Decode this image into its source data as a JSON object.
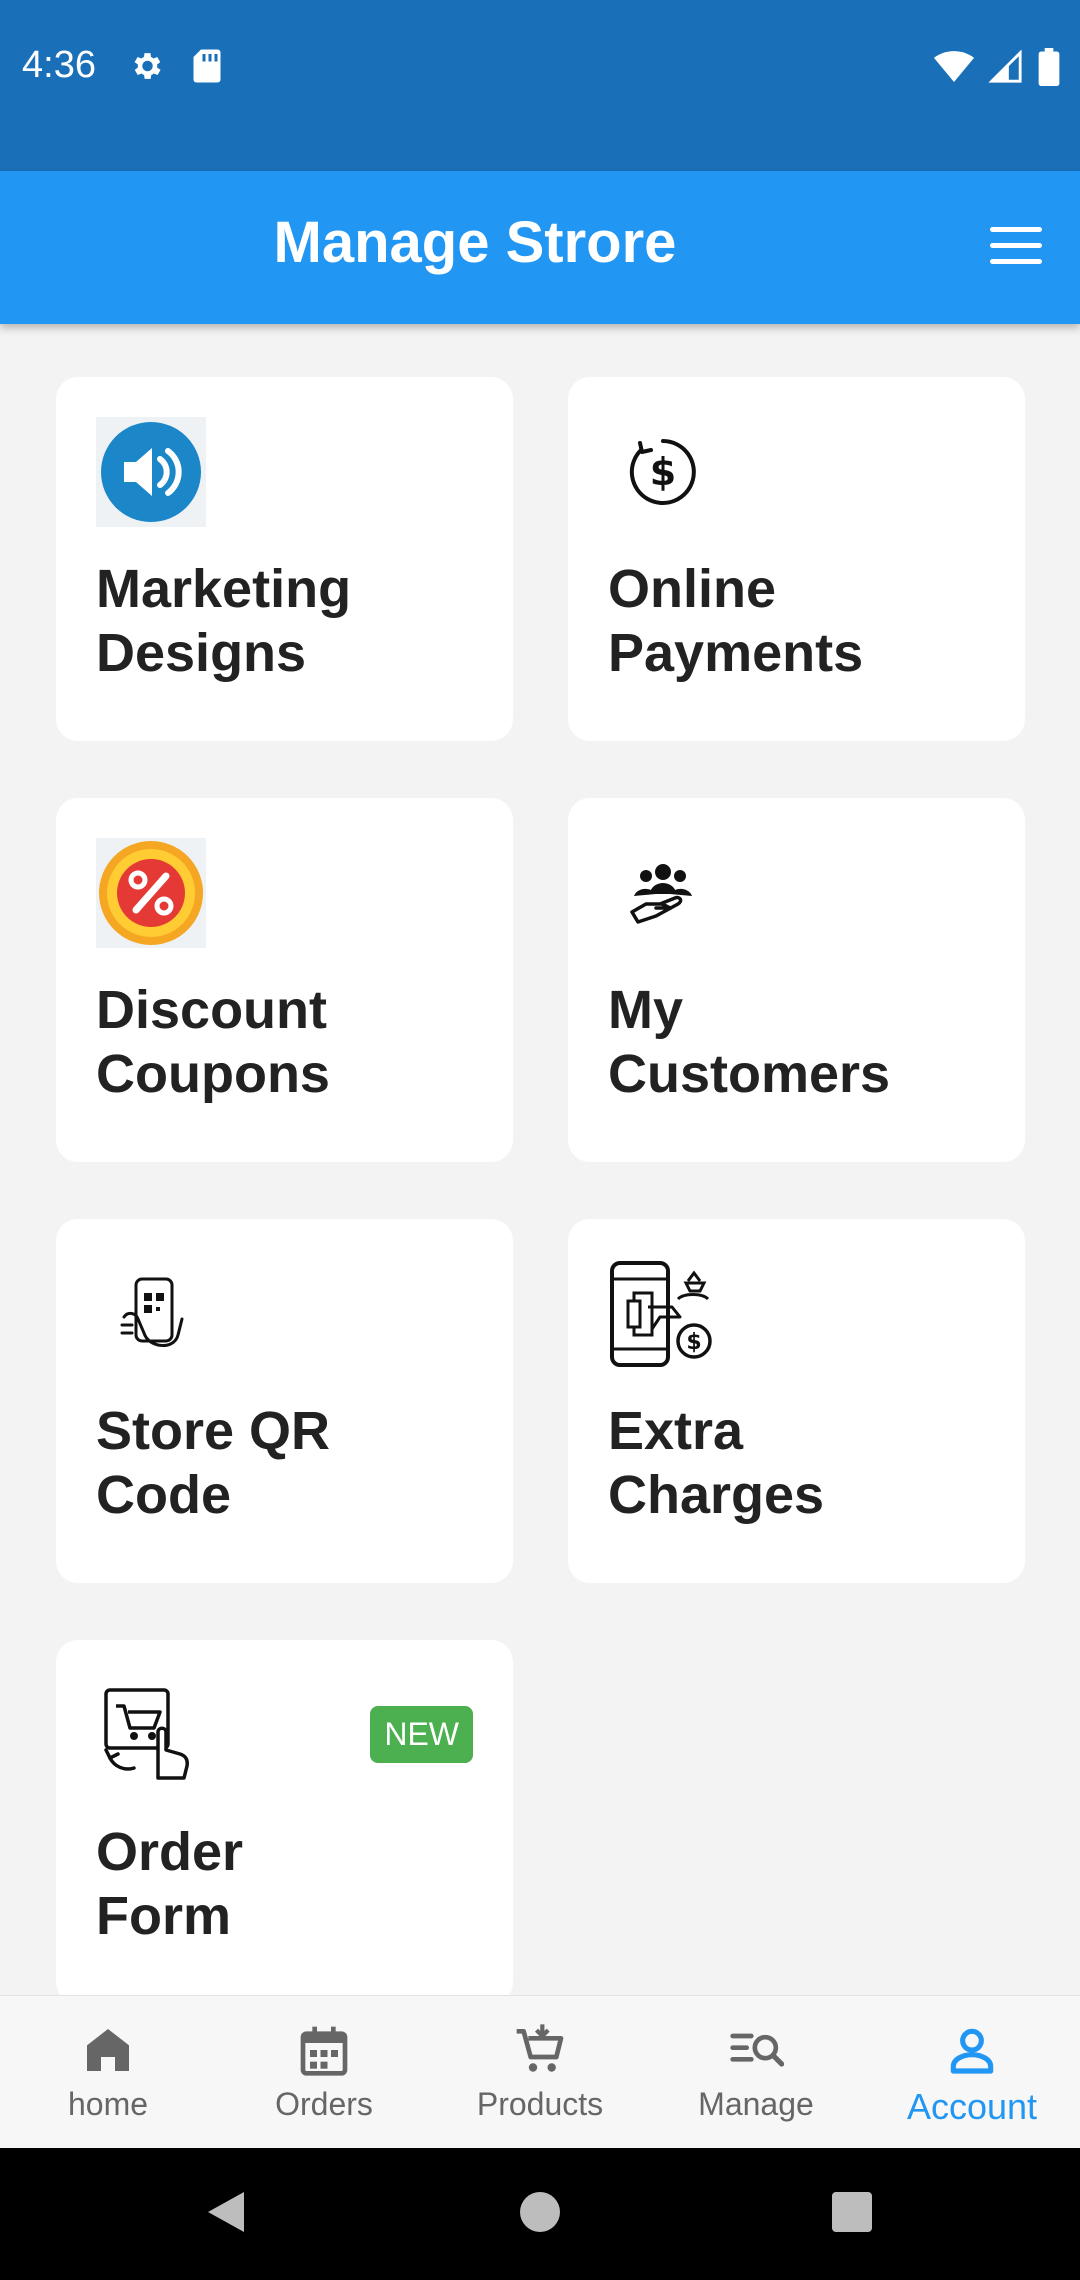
{
  "status": {
    "time": "4:36"
  },
  "appbar": {
    "title": "Manage Strore"
  },
  "cards": [
    {
      "line1": "Marketing",
      "line2": "Designs",
      "icon": "speaker-icon"
    },
    {
      "line1": "Online",
      "line2": "Payments",
      "icon": "dollar-refresh-icon"
    },
    {
      "line1": "Discount",
      "line2": "Coupons",
      "icon": "percent-badge-icon"
    },
    {
      "line1": "My",
      "line2": "Customers",
      "icon": "customers-hand-icon"
    },
    {
      "line1": "Store QR",
      "line2": "Code",
      "icon": "phone-qr-icon"
    },
    {
      "line1": "Extra",
      "line2": "Charges",
      "icon": "phone-moneybag-icon"
    },
    {
      "line1": "Order",
      "line2": "Form",
      "icon": "cart-touch-icon",
      "badge": "NEW"
    }
  ],
  "bottom_nav": [
    {
      "label": "home",
      "icon": "home-icon"
    },
    {
      "label": "Orders",
      "icon": "calendar-icon"
    },
    {
      "label": "Products",
      "icon": "cart-icon"
    },
    {
      "label": "Manage",
      "icon": "manage-search-icon"
    },
    {
      "label": "Account",
      "icon": "person-icon",
      "active": true
    }
  ],
  "colors": {
    "statusbar": "#1a6fb9",
    "appbar": "#2196f3",
    "active": "#2196f3",
    "badge": "#4caf50"
  }
}
